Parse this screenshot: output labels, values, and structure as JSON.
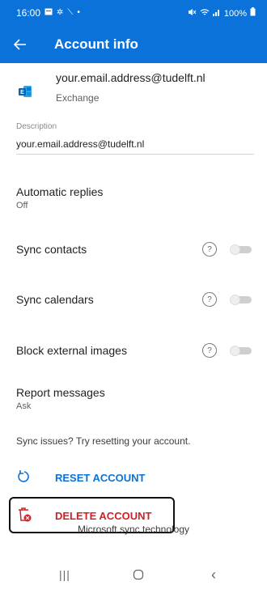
{
  "status_bar": {
    "time": "16:00",
    "battery": "100%",
    "icons": [
      "calendar-icon",
      "gear-icon",
      "wrench-icon",
      "dot-icon",
      "mute-icon",
      "wifi-icon",
      "signal-icon",
      "battery-icon"
    ]
  },
  "app_bar": {
    "back_icon": "arrow-left-icon",
    "title": "Account info"
  },
  "account": {
    "email": "your.email.address@tudelft.nl",
    "type": "Exchange",
    "icon": "exchange-icon"
  },
  "description": {
    "label": "Description",
    "value": "your.email.address@tudelft.nl"
  },
  "settings": {
    "automatic_replies": {
      "label": "Automatic replies",
      "value": "Off"
    },
    "sync_contacts": {
      "label": "Sync contacts",
      "help": "?",
      "enabled": false
    },
    "sync_calendars": {
      "label": "Sync calendars",
      "help": "?",
      "enabled": false
    },
    "block_external_images": {
      "label": "Block external images",
      "help": "?",
      "enabled": false
    },
    "report_messages": {
      "label": "Report messages",
      "value": "Ask"
    }
  },
  "sync_issues_text": "Sync issues? Try resetting your account.",
  "actions": {
    "reset": {
      "label": "RESET ACCOUNT",
      "icon": "refresh-icon",
      "color": "#0a72d8"
    },
    "delete": {
      "label": "DELETE ACCOUNT",
      "icon": "trash-delete-icon",
      "color": "#d02028"
    }
  },
  "footer_text": "Microsoft sync technology",
  "nav_bar": {
    "recents": "|||",
    "home": "○",
    "back": "‹"
  },
  "colors": {
    "brand_blue": "#0a72d8",
    "danger_red": "#d02028"
  }
}
